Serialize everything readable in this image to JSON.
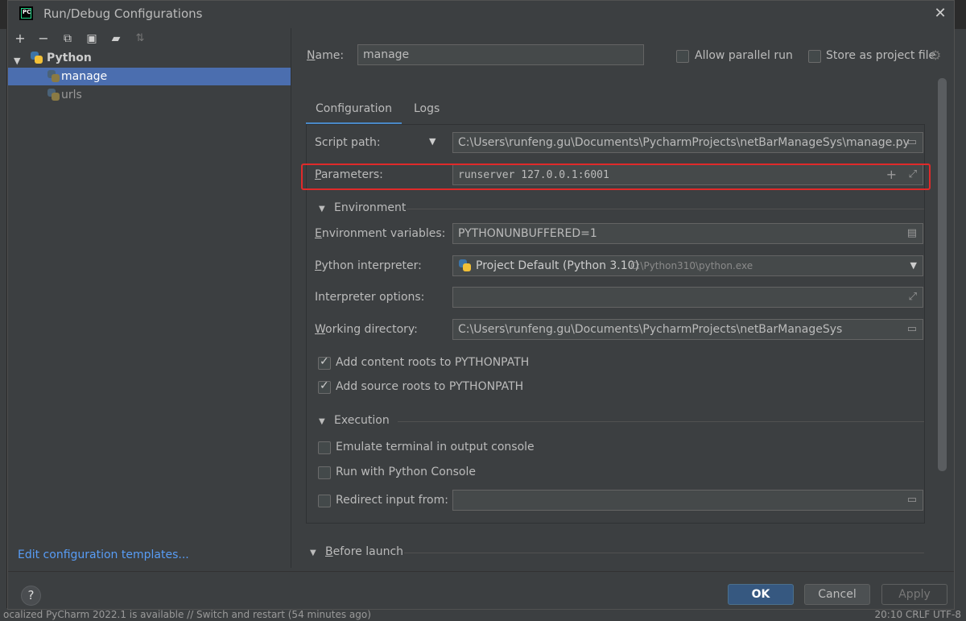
{
  "window": {
    "title": "Run/Debug Configurations"
  },
  "toolbar": [
    "add-icon",
    "remove-icon",
    "copy-icon",
    "save-icon",
    "new-folder-icon",
    "sort-icon"
  ],
  "tree": {
    "group": "Python",
    "items": [
      "manage",
      "urls"
    ]
  },
  "left": {
    "templates_link": "Edit configuration templates..."
  },
  "name": {
    "label": "Name:",
    "value": "manage"
  },
  "options": {
    "parallel": "Allow parallel run",
    "store": "Store as project file"
  },
  "tabs": [
    "Configuration",
    "Logs"
  ],
  "config": {
    "script_path_label": "Script path:",
    "script_path": "C:\\Users\\runfeng.gu\\Documents\\PycharmProjects\\netBarManageSys\\manage.py",
    "parameters_label": "Parameters:",
    "parameters": "runserver 127.0.0.1:6001",
    "environment_section": "Environment",
    "env_vars_label": "Environment variables:",
    "env_vars": "PYTHONUNBUFFERED=1",
    "interpreter_label": "Python interpreter:",
    "interpreter": "Project Default (Python 3.10)",
    "interpreter_path": "C:\\Python310\\python.exe",
    "interp_options_label": "Interpreter options:",
    "interp_options": "",
    "workdir_label": "Working directory:",
    "workdir": "C:\\Users\\runfeng.gu\\Documents\\PycharmProjects\\netBarManageSys",
    "content_roots": "Add content roots to PYTHONPATH",
    "source_roots": "Add source roots to PYTHONPATH",
    "execution_section": "Execution",
    "emulate_terminal": "Emulate terminal in output console",
    "python_console": "Run with Python Console",
    "redirect_input": "Redirect input from:",
    "redirect_value": ""
  },
  "before_launch": "Before launch",
  "buttons": {
    "ok": "OK",
    "cancel": "Cancel",
    "apply": "Apply"
  },
  "status": {
    "left": "ocalized PyCharm 2022.1 is available // Switch and restart (54 minutes ago)",
    "right": "20:10  CRLF  UTF-8"
  },
  "colors": {
    "accent": "#4b6eaf",
    "highlight": "#e02a2a",
    "ok": "#365880"
  }
}
